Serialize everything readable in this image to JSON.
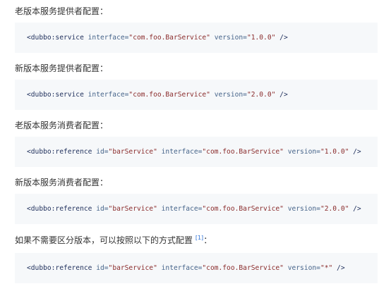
{
  "blocks": [
    {
      "heading": "老版本服务提供者配置：",
      "code": {
        "tag": "<dubbo:service",
        "attrs": [
          {
            "name": "interface",
            "value": "\"com.foo.BarService\""
          },
          {
            "name": "version",
            "value": "\"1.0.0\""
          }
        ],
        "close": "/>"
      }
    },
    {
      "heading": "新版本服务提供者配置：",
      "code": {
        "tag": "<dubbo:service",
        "attrs": [
          {
            "name": "interface",
            "value": "\"com.foo.BarService\""
          },
          {
            "name": "version",
            "value": "\"2.0.0\""
          }
        ],
        "close": "/>"
      }
    },
    {
      "heading": "老版本服务消费者配置：",
      "code": {
        "tag": "<dubbo:reference",
        "attrs": [
          {
            "name": "id",
            "value": "\"barService\""
          },
          {
            "name": "interface",
            "value": "\"com.foo.BarService\""
          },
          {
            "name": "version",
            "value": "\"1.0.0\""
          }
        ],
        "close": "/>"
      }
    },
    {
      "heading": "新版本服务消费者配置：",
      "code": {
        "tag": "<dubbo:reference",
        "attrs": [
          {
            "name": "id",
            "value": "\"barService\""
          },
          {
            "name": "interface",
            "value": "\"com.foo.BarService\""
          },
          {
            "name": "version",
            "value": "\"2.0.0\""
          }
        ],
        "close": "/>"
      }
    },
    {
      "heading": "如果不需要区分版本，可以按照以下的方式配置",
      "footnote": "[1]",
      "heading_suffix": "：",
      "code": {
        "tag": "<dubbo:reference",
        "attrs": [
          {
            "name": "id",
            "value": "\"barService\""
          },
          {
            "name": "interface",
            "value": "\"com.foo.BarService\""
          },
          {
            "name": "version",
            "value": "\"*\""
          }
        ],
        "close": "/>"
      }
    }
  ],
  "colors": {
    "code_background": "#f6f8fa",
    "text": "#333333",
    "tag": "#22325e",
    "attribute": "#46648a",
    "string": "#8a2b2b",
    "link": "#2a6fd6"
  }
}
